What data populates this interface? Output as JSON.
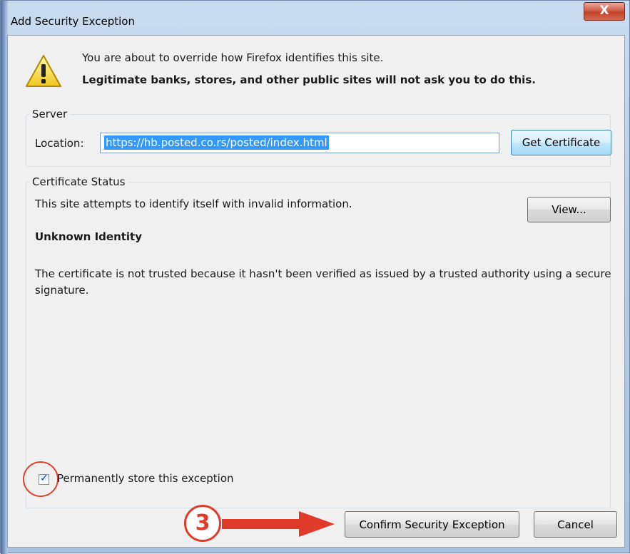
{
  "window": {
    "title": "Add Security Exception",
    "close_label": "X"
  },
  "warning": {
    "line1": "You are about to override how Firefox identifies this site.",
    "line2": "Legitimate banks, stores, and other public sites will not ask you to do this."
  },
  "server": {
    "legend": "Server",
    "location_label": "Location:",
    "location_value": "https://hb.posted.co.rs/posted/index.html",
    "get_certificate_label": "Get Certificate"
  },
  "certificate_status": {
    "legend": "Certificate Status",
    "summary": "This site attempts to identify itself with invalid information.",
    "view_label": "View...",
    "heading": "Unknown Identity",
    "description": "The certificate is not trusted because it hasn't been verified as issued by a trusted authority using a secure signature."
  },
  "permanent_store": {
    "label": "Permanently store this exception",
    "checked": true
  },
  "annotation": {
    "step_number": "3",
    "color": "#e03a2a"
  },
  "buttons": {
    "confirm_label": "Confirm Security Exception",
    "cancel_label": "Cancel"
  },
  "icons": {
    "warning": "warning-triangle-icon",
    "close": "close-icon",
    "check": "checkmark-icon",
    "arrow": "arrow-right-icon"
  }
}
